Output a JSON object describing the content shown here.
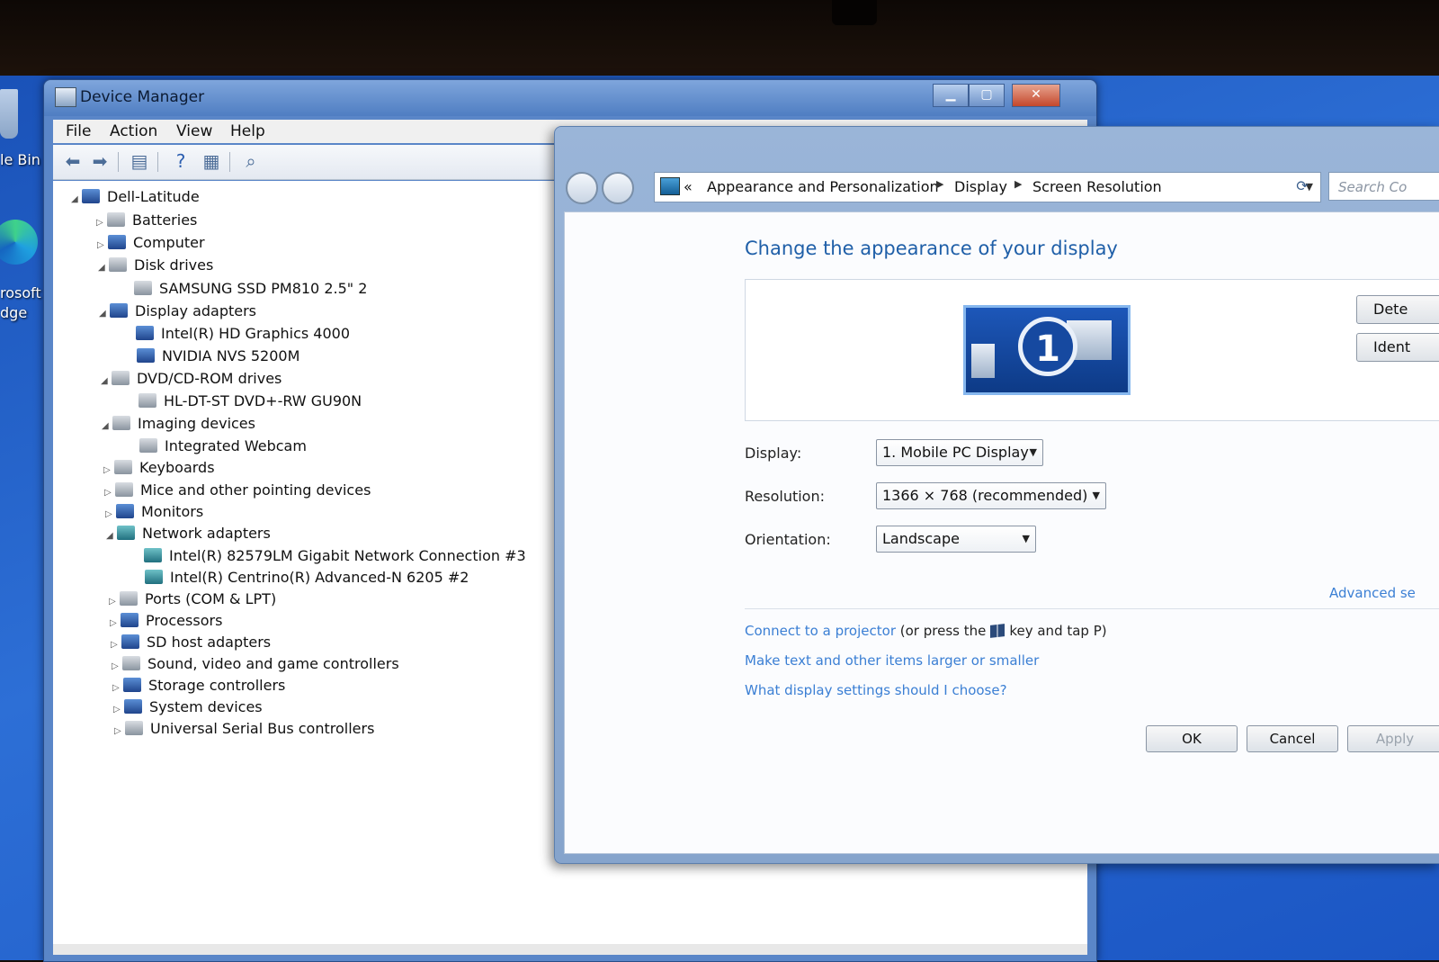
{
  "desktop": {
    "recycle_label": "le Bin",
    "edge_label_line1": "rosoft",
    "edge_label_line2": "dge"
  },
  "device_manager": {
    "title": "Device Manager",
    "menu": [
      "File",
      "Action",
      "View",
      "Help"
    ],
    "toolbar_icons": [
      "back-arrow-icon",
      "forward-arrow-icon",
      "show-hide-console-tree-icon",
      "help-icon",
      "properties-icon",
      "scan-hardware-icon"
    ],
    "tree": [
      {
        "label": "Dell-Latitude",
        "level": 0,
        "state": "expanded",
        "icon": "computer-icon"
      },
      {
        "label": "Batteries",
        "level": 1,
        "state": "collapsed",
        "icon": "battery-icon"
      },
      {
        "label": "Computer",
        "level": 1,
        "state": "collapsed",
        "icon": "computer-icon"
      },
      {
        "label": "Disk drives",
        "level": 1,
        "state": "expanded",
        "icon": "disk-drive-icon"
      },
      {
        "label": "SAMSUNG SSD PM810 2.5\" 2",
        "level": 2,
        "state": "leaf",
        "icon": "disk-drive-icon"
      },
      {
        "label": "Display adapters",
        "level": 1,
        "state": "expanded",
        "icon": "display-adapter-icon"
      },
      {
        "label": "Intel(R) HD Graphics 4000",
        "level": 2,
        "state": "leaf",
        "icon": "display-adapter-icon"
      },
      {
        "label": "NVIDIA NVS 5200M",
        "level": 2,
        "state": "leaf",
        "icon": "display-adapter-icon"
      },
      {
        "label": "DVD/CD-ROM drives",
        "level": 1,
        "state": "expanded",
        "icon": "dvd-drive-icon"
      },
      {
        "label": "HL-DT-ST DVD+-RW GU90N",
        "level": 2,
        "state": "leaf",
        "icon": "dvd-drive-icon"
      },
      {
        "label": "Imaging devices",
        "level": 1,
        "state": "expanded",
        "icon": "camera-icon"
      },
      {
        "label": "Integrated Webcam",
        "level": 2,
        "state": "leaf",
        "icon": "camera-icon"
      },
      {
        "label": "Keyboards",
        "level": 1,
        "state": "collapsed",
        "icon": "keyboard-icon"
      },
      {
        "label": "Mice and other pointing devices",
        "level": 1,
        "state": "collapsed",
        "icon": "mouse-icon"
      },
      {
        "label": "Monitors",
        "level": 1,
        "state": "collapsed",
        "icon": "monitor-icon"
      },
      {
        "label": "Network adapters",
        "level": 1,
        "state": "expanded",
        "icon": "network-adapter-icon"
      },
      {
        "label": "Intel(R) 82579LM Gigabit Network Connection #3",
        "level": 2,
        "state": "leaf",
        "icon": "network-adapter-icon"
      },
      {
        "label": "Intel(R) Centrino(R) Advanced-N 6205 #2",
        "level": 2,
        "state": "leaf",
        "icon": "network-adapter-icon"
      },
      {
        "label": "Ports (COM & LPT)",
        "level": 1,
        "state": "collapsed",
        "icon": "port-icon"
      },
      {
        "label": "Processors",
        "level": 1,
        "state": "collapsed",
        "icon": "processor-icon"
      },
      {
        "label": "SD host adapters",
        "level": 1,
        "state": "collapsed",
        "icon": "sd-card-icon"
      },
      {
        "label": "Sound, video and game controllers",
        "level": 1,
        "state": "collapsed",
        "icon": "speaker-icon"
      },
      {
        "label": "Storage controllers",
        "level": 1,
        "state": "collapsed",
        "icon": "storage-controller-icon"
      },
      {
        "label": "System devices",
        "level": 1,
        "state": "collapsed",
        "icon": "system-device-icon"
      },
      {
        "label": "Universal Serial Bus controllers",
        "level": 1,
        "state": "collapsed",
        "icon": "usb-icon"
      }
    ]
  },
  "screen_resolution": {
    "address": {
      "chevron": "«",
      "segments": [
        "Appearance and Personalization",
        "Display",
        "Screen Resolution"
      ]
    },
    "search_placeholder": "Search Co",
    "heading": "Change the appearance of your display",
    "monitor_number": "1",
    "detect_button": "Dete",
    "identify_button": "Ident",
    "display_label": "Display:",
    "display_value": "1. Mobile PC Display",
    "resolution_label": "Resolution:",
    "resolution_value": "1366 × 768 (recommended)",
    "orientation_label": "Orientation:",
    "orientation_value": "Landscape",
    "advanced_link": "Advanced se",
    "projector_link": "Connect to a projector",
    "projector_hint_before": "(or press the",
    "projector_hint_after": "key and tap P)",
    "text_size_link": "Make text and other items larger or smaller",
    "settings_link": "What display settings should I choose?",
    "ok_button": "OK",
    "cancel_button": "Cancel",
    "apply_button": "Apply"
  }
}
